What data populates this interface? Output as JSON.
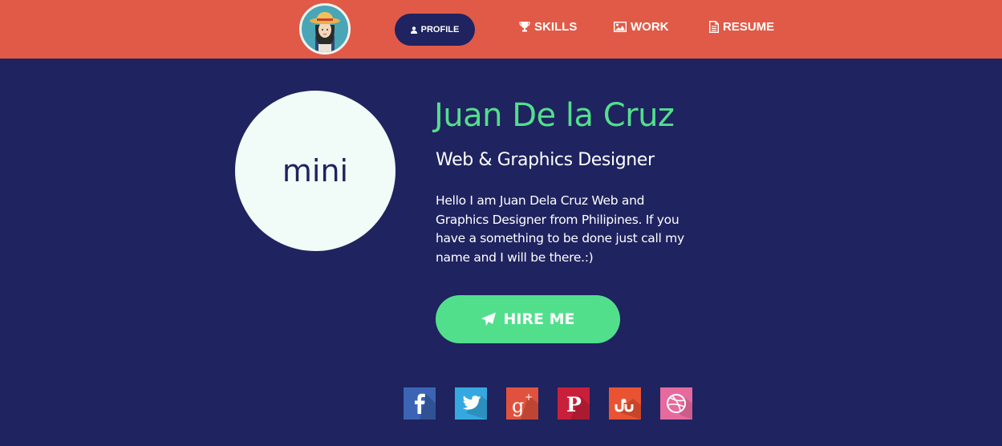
{
  "nav": {
    "profile_label": "PROFILE",
    "skills_label": "SKILLS",
    "work_label": "WORK",
    "resume_label": "RESUME",
    "profile_icon": "user-icon",
    "skills_icon": "trophy-icon",
    "work_icon": "image-icon",
    "resume_icon": "document-icon"
  },
  "profile": {
    "avatar_text": "mini",
    "name": "Juan De la Cruz",
    "title": "Web & Graphics Designer",
    "bio": "Hello I am Juan Dela Cruz Web and Graphics Designer from Philipines. If you have a something to be done just call my name and I will be there.:)",
    "hire_label": "HIRE ME",
    "hire_icon": "paper-plane-icon"
  },
  "social": [
    "facebook",
    "twitter",
    "google-plus",
    "pinterest",
    "stumbleupon",
    "dribbble"
  ],
  "colors": {
    "header_bg": "#e15a47",
    "page_bg": "#1f235f",
    "accent_green": "#52df8c",
    "avatar_circle": "#f1fbf7"
  }
}
